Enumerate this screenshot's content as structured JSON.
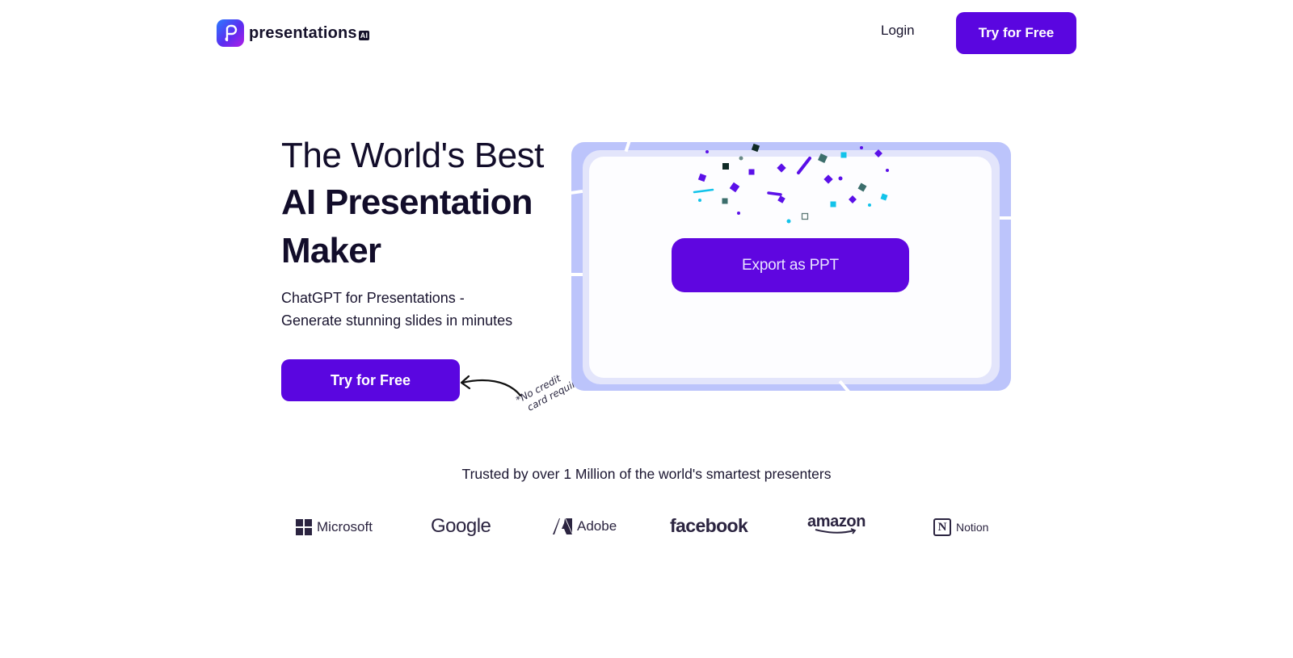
{
  "header": {
    "brand": "presentations",
    "brand_suffix": "AI",
    "login_label": "Login",
    "try_label": "Try for Free"
  },
  "hero": {
    "title_line1": "The World's Best",
    "title_line2": "AI Presentation",
    "title_line3": "Maker",
    "subtitle_line1": "ChatGPT for Presentations -",
    "subtitle_line2": "Generate stunning slides in minutes",
    "cta_label": "Try for Free",
    "note_line1": "*No credit",
    "note_line2": "card required"
  },
  "preview": {
    "export_label": "Export as PPT"
  },
  "trust": {
    "headline": "Trusted by over 1 Million of the world's smartest presenters",
    "logos": [
      {
        "name": "Microsoft",
        "icon": "windows-grid-icon"
      },
      {
        "name": "Google",
        "icon": ""
      },
      {
        "name": "Adobe",
        "icon": "adobe-a-icon"
      },
      {
        "name": "facebook",
        "icon": ""
      },
      {
        "name": "amazon",
        "icon": "amazon-smile-icon"
      },
      {
        "name": "Notion",
        "icon": "notion-n-icon"
      }
    ]
  },
  "colors": {
    "accent": "#5a06e0",
    "text": "#120d2a",
    "preview_frame": "#bcc4fb",
    "confetti_purple": "#5b10e8",
    "confetti_cyan": "#12c3ea",
    "confetti_teal": "#3c6e6c",
    "confetti_dark": "#0f2a26"
  }
}
